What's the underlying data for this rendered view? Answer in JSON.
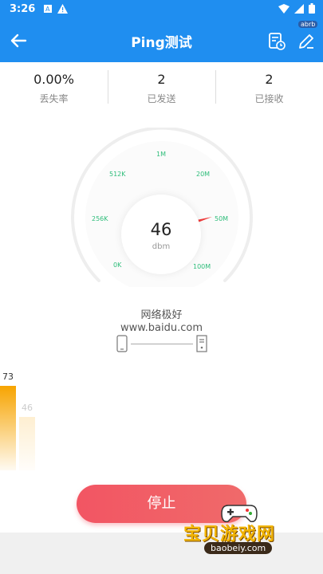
{
  "status_bar": {
    "time": "3:26",
    "badge": "abrb"
  },
  "app_bar": {
    "title": "Ping测试"
  },
  "stats": [
    {
      "value": "0.00%",
      "label": "丢失率"
    },
    {
      "value": "2",
      "label": "已发送"
    },
    {
      "value": "2",
      "label": "已接收"
    }
  ],
  "gauge": {
    "labels": [
      "0K",
      "256K",
      "512K",
      "1M",
      "20M",
      "50M",
      "100M"
    ],
    "value": "46",
    "unit": "dbm"
  },
  "network": {
    "quality": "网络极好",
    "host": "www.baidu.com"
  },
  "chart_data": {
    "type": "bar",
    "values": [
      73,
      46
    ]
  },
  "stop_label": "停止",
  "watermark": {
    "text": "宝贝游戏网",
    "url": "baobeiy.com"
  },
  "colors": {
    "primary": "#1f8ef0",
    "accent": "#f25563",
    "gauge_label": "#2ebd7a",
    "bar_primary": "#f7a400"
  }
}
